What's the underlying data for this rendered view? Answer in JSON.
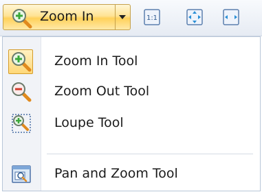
{
  "toolbar": {
    "zoom_button_label": "Zoom In",
    "zoom_button_icon": "zoom-in-magnifier-icon",
    "icons": [
      "actual-size-1-1-icon",
      "fit-page-icon",
      "fit-width-icon"
    ],
    "actual_size_text": "1:1"
  },
  "menu": {
    "items": [
      {
        "label": "Zoom In Tool",
        "icon": "zoom-in-magnifier-icon",
        "checked": true
      },
      {
        "label": "Zoom Out Tool",
        "icon": "zoom-out-magnifier-icon",
        "checked": false
      },
      {
        "label": "Loupe Tool",
        "icon": "loupe-icon",
        "checked": false
      },
      {
        "label": "Pan and Zoom Tool",
        "icon": "pan-and-zoom-icon",
        "checked": false
      }
    ]
  },
  "colors": {
    "hover_gold": "#ffd15a",
    "hover_border": "#c5a04a",
    "menu_border": "#b8c6d8",
    "plus_green": "#3aa83a",
    "minus_red": "#d23a2a",
    "handle_orange": "#e08a1e"
  }
}
